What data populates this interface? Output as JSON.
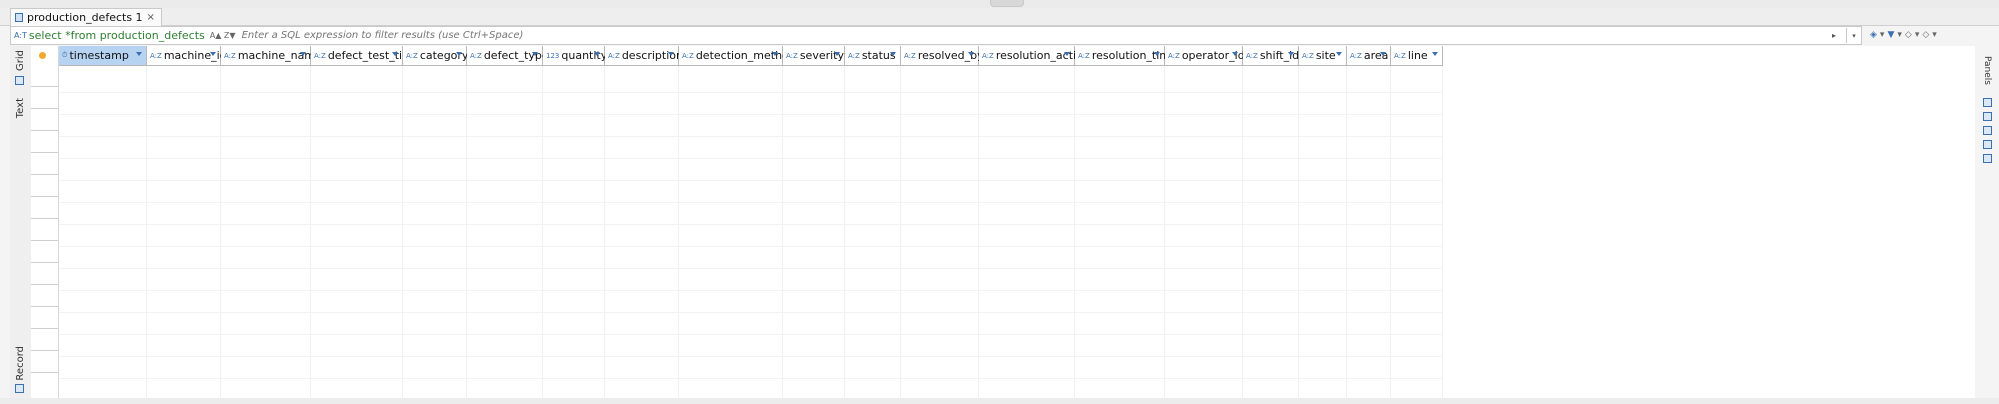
{
  "tab": {
    "title": "production_defects 1",
    "close": "×"
  },
  "filter": {
    "prefix": "A:T",
    "query": "select *from production_defects",
    "sort_glyph": "A▲ Z▼",
    "placeholder": "Enter a SQL expression to filter results (use Ctrl+Space)",
    "end_glyph": "▸",
    "drop_glyph": "▾"
  },
  "left_panel": {
    "grid_label": "Grid",
    "text_label": "Text",
    "record_label": "Record"
  },
  "right_panel": {
    "label": "Panels"
  },
  "columns": [
    {
      "type": "clock",
      "icon": "⏱",
      "name": "timestamp",
      "selected": true
    },
    {
      "type": "text",
      "icon": "A:Z",
      "name": "machine_id"
    },
    {
      "type": "text",
      "icon": "A:Z",
      "name": "machine_name"
    },
    {
      "type": "text",
      "icon": "A:Z",
      "name": "defect_test_time"
    },
    {
      "type": "text",
      "icon": "A:Z",
      "name": "category"
    },
    {
      "type": "text",
      "icon": "A:Z",
      "name": "defect_type"
    },
    {
      "type": "number",
      "icon": "123",
      "name": "quantity"
    },
    {
      "type": "text",
      "icon": "A:Z",
      "name": "description"
    },
    {
      "type": "text",
      "icon": "A:Z",
      "name": "detection_method"
    },
    {
      "type": "text",
      "icon": "A:Z",
      "name": "severity"
    },
    {
      "type": "text",
      "icon": "A:Z",
      "name": "status"
    },
    {
      "type": "text",
      "icon": "A:Z",
      "name": "resolved_by"
    },
    {
      "type": "text",
      "icon": "A:Z",
      "name": "resolution_action"
    },
    {
      "type": "text",
      "icon": "A:Z",
      "name": "resolution_time"
    },
    {
      "type": "text",
      "icon": "A:Z",
      "name": "operator_id"
    },
    {
      "type": "text",
      "icon": "A:Z",
      "name": "shift_id"
    },
    {
      "type": "text",
      "icon": "A:Z",
      "name": "site"
    },
    {
      "type": "text",
      "icon": "A:Z",
      "name": "area"
    },
    {
      "type": "text",
      "icon": "A:Z",
      "name": "line"
    }
  ],
  "toolbar_icons": [
    "eraser-icon",
    "filter-icon",
    "back-icon",
    "forward-icon"
  ],
  "colors": {
    "accent": "#3a6fb0",
    "selected_header": "#b7d3f2",
    "query_text": "#2e7d32"
  }
}
